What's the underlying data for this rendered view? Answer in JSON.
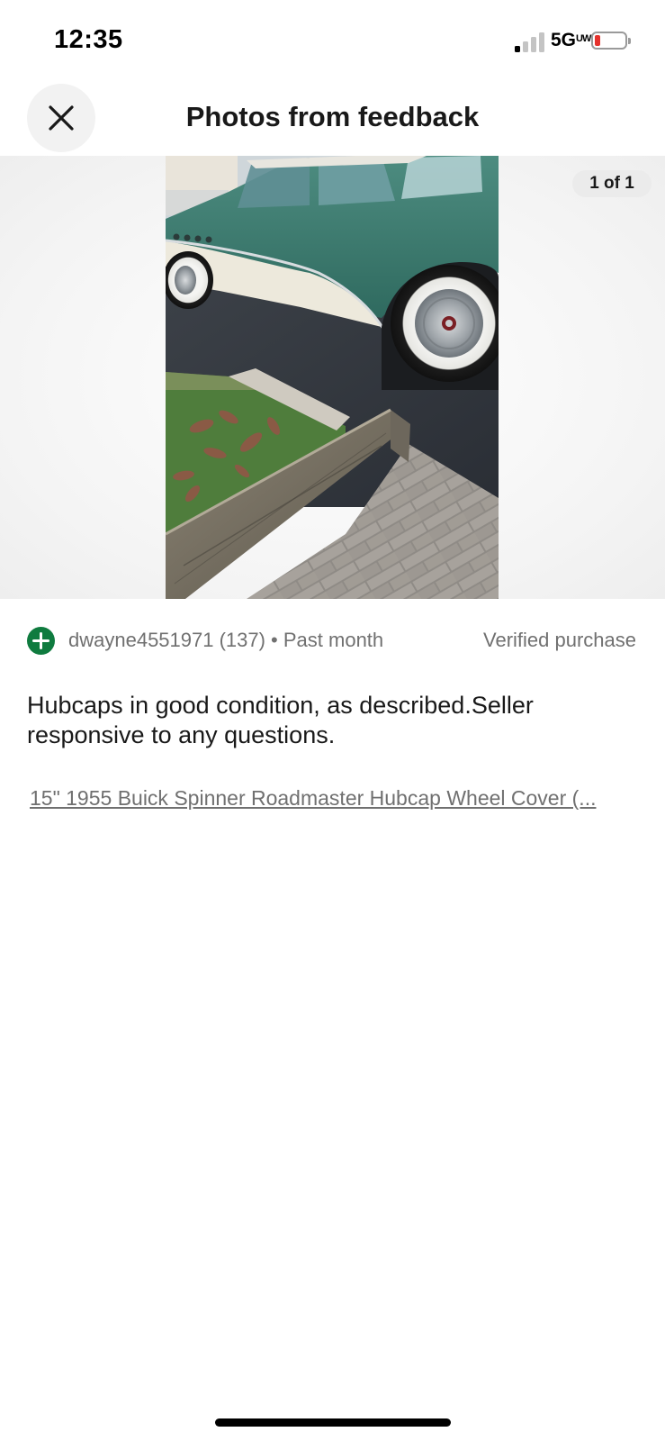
{
  "status_bar": {
    "time": "12:35",
    "network": "5G",
    "network_suffix": "UW",
    "icons": [
      "signal-icon",
      "battery-icon"
    ]
  },
  "header": {
    "title": "Photos from feedback",
    "close_icon": "close-icon"
  },
  "gallery": {
    "counter": "1 of 1",
    "photo": "vintage green and white car with whitewall tire parked beside a timber curb and brick walkway"
  },
  "feedback": {
    "user": "dwayne4551971 (137) • Past month",
    "verified": "Verified purchase",
    "badge_icon": "positive-plus-icon",
    "badge_color": "#0f7b3f",
    "comment": "Hubcaps in good condition, as described.Seller responsive to any questions.",
    "item_link": "15\" 1955 Buick Spinner Roadmaster Hubcap Wheel Cover (..."
  }
}
